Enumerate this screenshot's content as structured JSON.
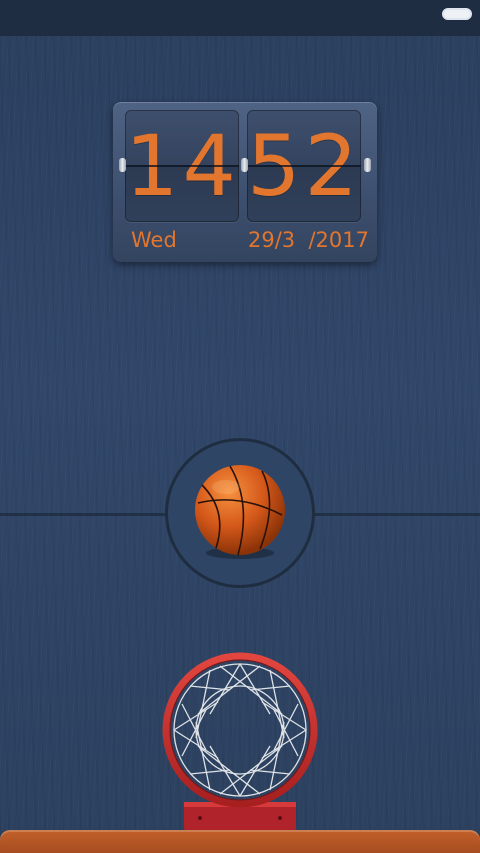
{
  "status_bar": {
    "battery_icon": "battery-icon"
  },
  "clock": {
    "hours": "14",
    "minutes": "52",
    "day": "Wed",
    "date": "29/3  /2017",
    "digit_color": "#e2762f"
  },
  "scene": {
    "ball_icon": "basketball-icon",
    "hoop_icon": "basketball-hoop-icon"
  }
}
